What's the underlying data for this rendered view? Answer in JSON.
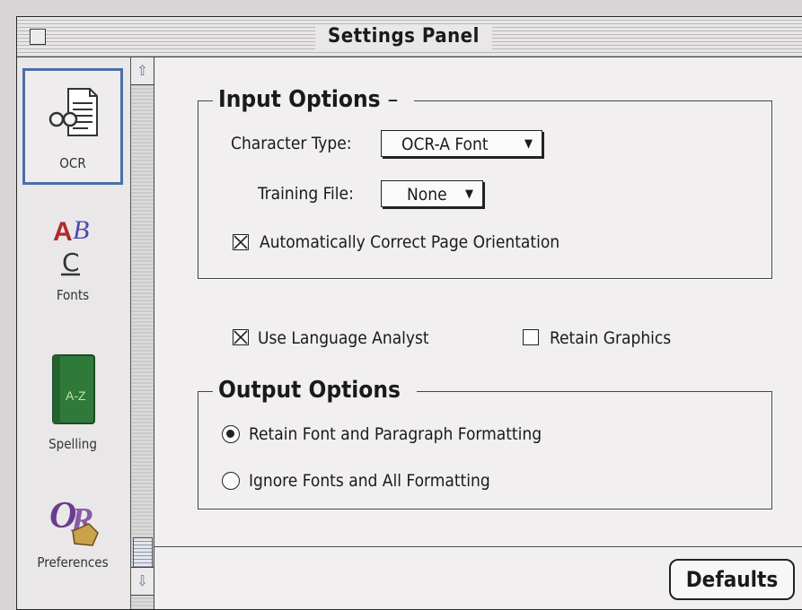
{
  "window": {
    "title": "Settings Panel"
  },
  "sidebar": {
    "items": [
      {
        "label": "OCR",
        "icon": "glasses-document-icon",
        "selected": true
      },
      {
        "label": "Fonts",
        "icon": "fonts-abc-icon",
        "selected": false
      },
      {
        "label": "Spelling",
        "icon": "green-book-icon",
        "selected": false
      },
      {
        "label": "Preferences",
        "icon": "preferences-logo-icon",
        "selected": false
      }
    ]
  },
  "input_options": {
    "title": "Input Options",
    "character_type_label": "Character Type:",
    "character_type_value": "OCR-A Font",
    "training_file_label": "Training File:",
    "training_file_value": "None",
    "auto_orient_label": "Automatically Correct Page Orientation",
    "auto_orient_checked": true
  },
  "misc": {
    "language_analyst_label": "Use Language Analyst",
    "language_analyst_checked": true,
    "retain_graphics_label": "Retain Graphics",
    "retain_graphics_checked": false
  },
  "output_options": {
    "title": "Output Options",
    "retain_format_label": "Retain Font and Paragraph Formatting",
    "ignore_format_label": "Ignore Fonts and All Formatting",
    "selected": "retain"
  },
  "buttons": {
    "defaults_label": "Defaults"
  },
  "colors": {
    "selection_border": "#4a6fa5",
    "scroll_arrow": "#5a6fa0"
  }
}
